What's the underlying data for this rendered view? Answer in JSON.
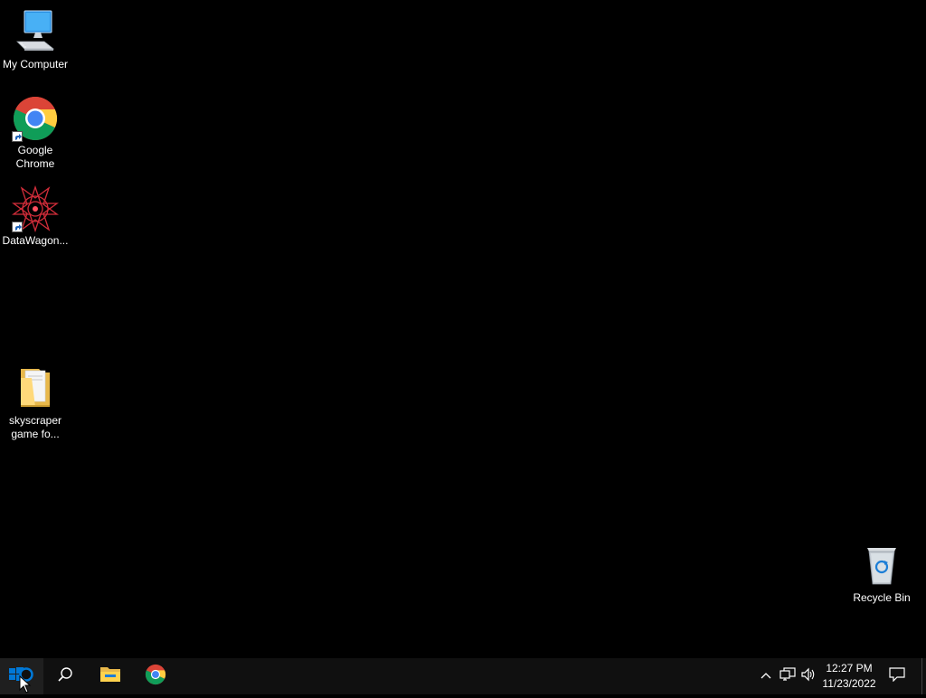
{
  "desktop": {
    "icons": [
      {
        "label": "My Computer",
        "icon": "computer-icon"
      },
      {
        "label": "Google Chrome",
        "icon": "chrome-icon"
      },
      {
        "label": "DataWagon...",
        "icon": "datawagon-icon"
      },
      {
        "label": "skyscraper game fo...",
        "icon": "folder-icon"
      },
      {
        "label": "Recycle Bin",
        "icon": "recycle-bin-icon"
      }
    ]
  },
  "taskbar": {
    "buttons": [
      {
        "name": "start",
        "icon": "windows-start-icon"
      },
      {
        "name": "search",
        "icon": "search-icon"
      },
      {
        "name": "file-explorer",
        "icon": "file-explorer-icon"
      },
      {
        "name": "chrome",
        "icon": "chrome-icon"
      }
    ],
    "tray": {
      "icons": [
        "chevron-up-icon",
        "network-icon",
        "volume-icon"
      ],
      "time": "12:27 PM",
      "date": "11/23/2022",
      "notification_icon": "notification-icon"
    }
  },
  "colors": {
    "desktop_background": "#000000",
    "taskbar_background": "#101010",
    "accent": "#0078d7",
    "text": "#ffffff"
  }
}
